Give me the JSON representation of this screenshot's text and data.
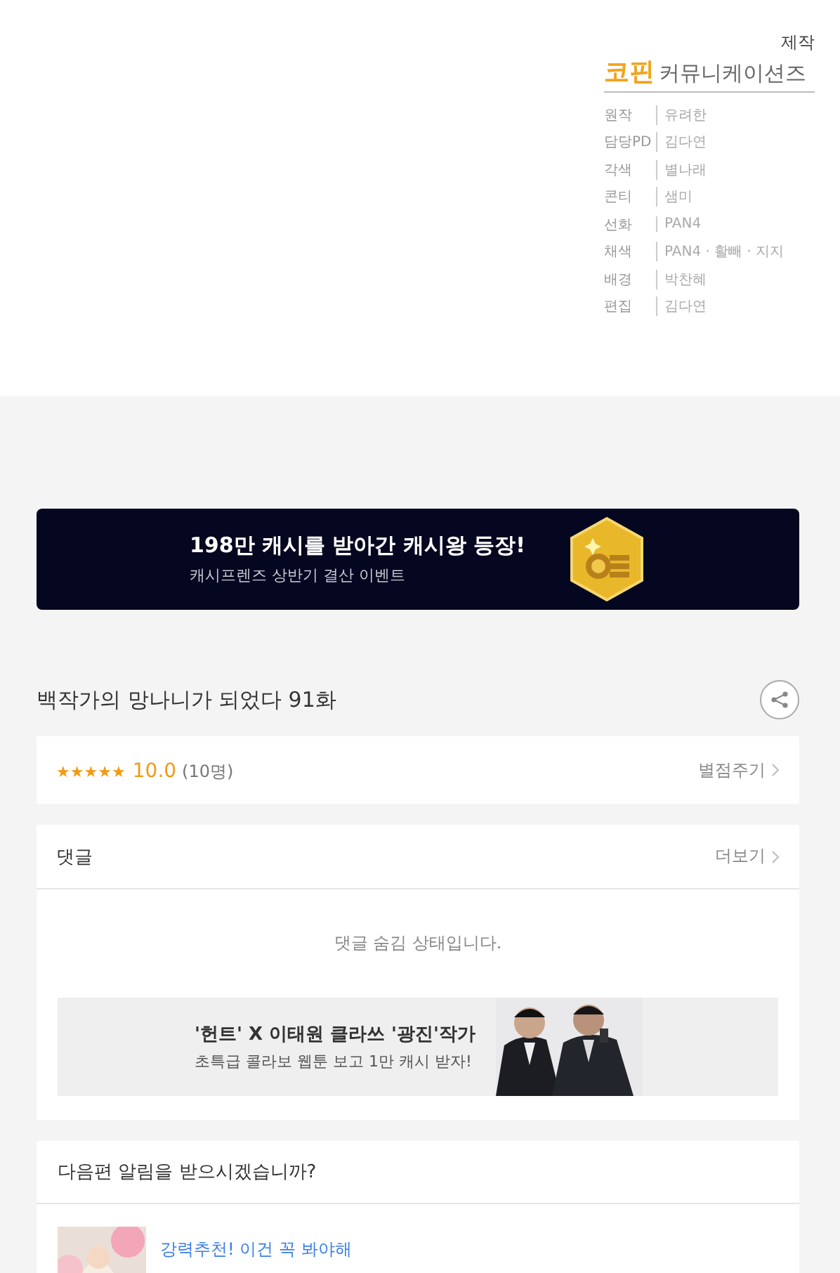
{
  "credits": {
    "heading": "제작",
    "studio_highlight": "코핀",
    "studio_rest": "커뮤니케이션즈",
    "rows": [
      {
        "role": "원작",
        "name": "유려한"
      },
      {
        "role": "담당PD",
        "name": "김다연"
      },
      {
        "role": "각색",
        "name": "별나래"
      },
      {
        "role": "콘티",
        "name": "샘미"
      },
      {
        "role": "선화",
        "name": "PAN4"
      },
      {
        "role": "채색",
        "name": "PAN4 · 활빼 · 지지"
      },
      {
        "role": "배경",
        "name": "박찬혜"
      },
      {
        "role": "편집",
        "name": "김다연"
      }
    ]
  },
  "event_banner": {
    "title": "198만 캐시를 받아간 캐시왕 등장!",
    "subtitle": "캐시프렌즈 상반기 결산 이벤트"
  },
  "episode_title": "백작가의 망나니가 되었다 91화",
  "rating": {
    "stars": 5,
    "score": "10.0",
    "count": "(10명)",
    "action": "별점주기"
  },
  "comments": {
    "heading": "댓글",
    "more": "더보기",
    "message": "댓글 숨김 상태입니다.",
    "ad": {
      "title": "'헌트' X 이태원 클라쓰 '광진'작가",
      "subtitle": "초특급 콜라보 웹툰 보고 1만 캐시 받자!"
    }
  },
  "notify": {
    "question": "다음편 알림을 받으시겠습니까?",
    "recommend": "강력추천! 이건 꼭 봐야해"
  }
}
